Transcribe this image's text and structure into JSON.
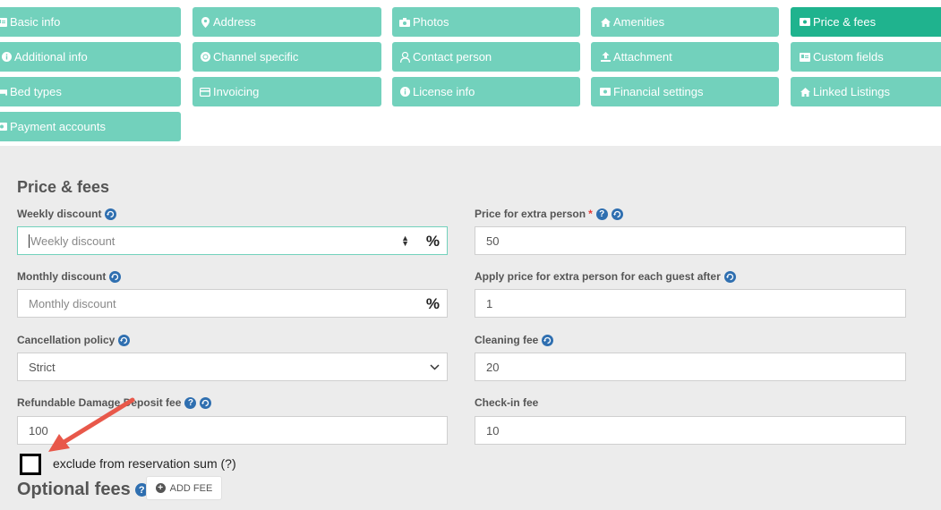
{
  "tabs": {
    "basic_info": "Basic info",
    "address": "Address",
    "photos": "Photos",
    "amenities": "Amenities",
    "price_fees": "Price & fees",
    "additional_info": "Additional info",
    "channel_specific": "Channel specific",
    "contact_person": "Contact person",
    "attachment": "Attachment",
    "custom_fields": "Custom fields",
    "bed_types": "Bed types",
    "invoicing": "Invoicing",
    "license_info": "License info",
    "financial_settings": "Financial settings",
    "linked_listings": "Linked Listings",
    "payment_accounts": "Payment accounts"
  },
  "colors": {
    "tab": "#72d1bc",
    "tab_active": "#1fb38e",
    "panel": "#ececec",
    "info_icon": "#2f6fb0",
    "arrow": "#e8584a"
  },
  "form": {
    "section_title": "Price & fees",
    "weekly_discount": {
      "label": "Weekly discount",
      "placeholder": "Weekly discount",
      "suffix": "%"
    },
    "monthly_discount": {
      "label": "Monthly discount",
      "placeholder": "Monthly discount",
      "suffix": "%"
    },
    "cancellation_policy": {
      "label": "Cancellation policy",
      "value": "Strict"
    },
    "damage_deposit": {
      "label": "Refundable Damage Deposit fee",
      "value": "100"
    },
    "extra_person_price": {
      "label": "Price for extra person",
      "required": "*",
      "value": "50"
    },
    "extra_person_after": {
      "label": "Apply price for extra person for each guest after",
      "value": "1"
    },
    "cleaning_fee": {
      "label": "Cleaning fee",
      "value": "20"
    },
    "checkin_fee": {
      "label": "Check-in fee",
      "value": "10"
    },
    "exclude_checkbox_label": "exclude from reservation sum (?)",
    "optional_fees_title": "Optional fees",
    "add_fee_button": "ADD FEE"
  }
}
